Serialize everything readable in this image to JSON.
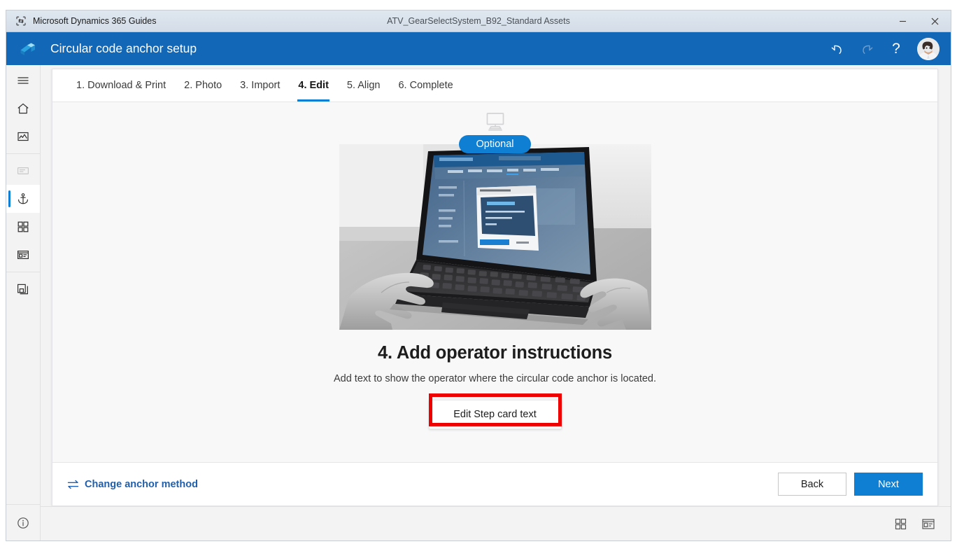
{
  "titlebar": {
    "app_name": "Microsoft Dynamics 365 Guides",
    "document_title": "ATV_GearSelectSystem_B92_Standard Assets",
    "minimize_label": "Minimize",
    "close_label": "Close"
  },
  "header": {
    "title": "Circular code anchor setup",
    "undo_label": "Undo",
    "redo_label": "Redo",
    "help_label": "?",
    "account_label": "Account"
  },
  "sidebar": {
    "items": [
      {
        "icon": "hamburger-menu-icon",
        "label": "Menu"
      },
      {
        "icon": "home-icon",
        "label": "Home"
      },
      {
        "icon": "media-icon",
        "label": "Media"
      },
      {
        "icon": "step-card-icon",
        "label": "Step card"
      },
      {
        "icon": "anchor-icon",
        "label": "Anchor"
      },
      {
        "icon": "grid-icon",
        "label": "Apps"
      },
      {
        "icon": "card-panel-icon",
        "label": "Card panel"
      },
      {
        "icon": "copy-icon",
        "label": "Copy"
      }
    ],
    "info_label": "Info"
  },
  "tabs": [
    {
      "label": "1. Download & Print",
      "active": false
    },
    {
      "label": "2. Photo",
      "active": false
    },
    {
      "label": "3. Import",
      "active": false
    },
    {
      "label": "4. Edit",
      "active": true
    },
    {
      "label": "5. Align",
      "active": false
    },
    {
      "label": "6. Complete",
      "active": false
    }
  ],
  "content": {
    "badge": "Optional",
    "device_icon": "pc-monitor-icon",
    "photo_alt": "Hands typing on a laptop showing the Guides PC app",
    "title": "4. Add operator instructions",
    "description": "Add text to show the operator where the circular code anchor is located.",
    "edit_button": "Edit Step card text",
    "annotation_color": "#ee0000"
  },
  "footer": {
    "change_method": "Change anchor method",
    "back": "Back",
    "next": "Next"
  },
  "statusbar": {
    "grid_view_label": "Grid view",
    "card_view_label": "Card view"
  },
  "colors": {
    "brand_blue": "#1267b6",
    "accent_blue": "#0f7fd4",
    "link_blue": "#1f5fad",
    "annotation_red": "#ee0000"
  }
}
